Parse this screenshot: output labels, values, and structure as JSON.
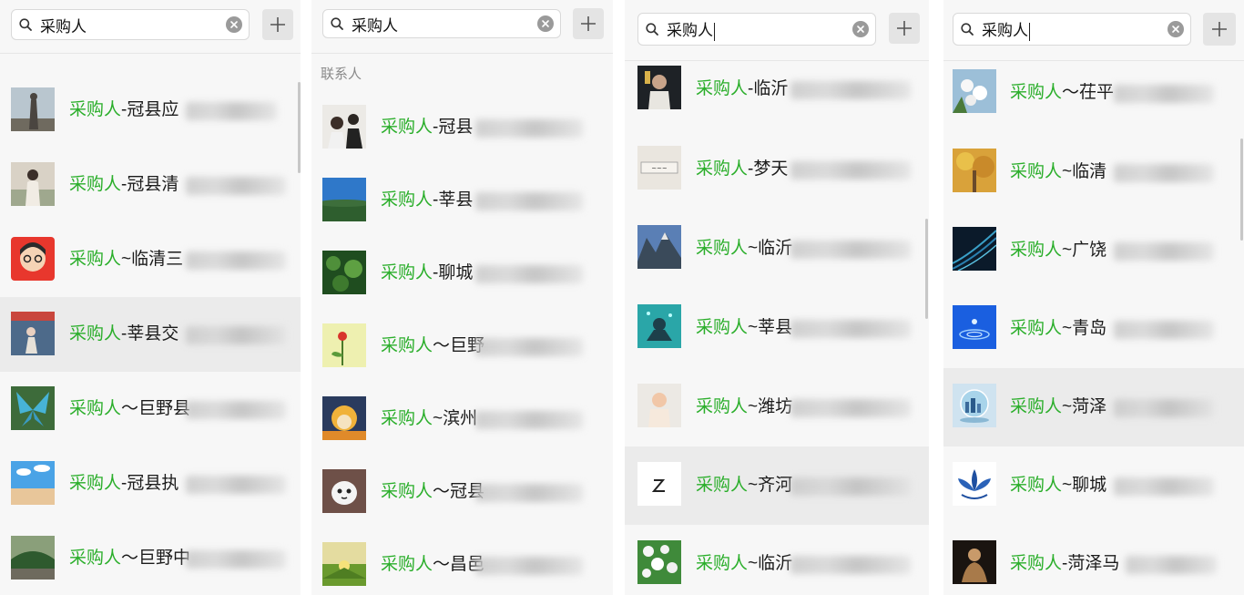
{
  "search": {
    "query": "采购人"
  },
  "panel2": {
    "section_label": "联系人"
  },
  "keyword": "采购人",
  "panel1": {
    "rows": [
      {
        "name": "-冠县应"
      },
      {
        "name": "-冠县清"
      },
      {
        "name": "~临清三"
      },
      {
        "name": "-莘县交"
      },
      {
        "name": "～巨野县"
      },
      {
        "name": "-冠县执"
      },
      {
        "name": "～巨野中"
      }
    ]
  },
  "panel2_rows": [
    {
      "name": "-冠县"
    },
    {
      "name": "-莘县"
    },
    {
      "name": "-聊城"
    },
    {
      "name": "～巨野"
    },
    {
      "name": "~滨州"
    },
    {
      "name": "～冠县"
    },
    {
      "name": "～昌邑"
    }
  ],
  "panel3_rows": [
    {
      "name": "-临沂"
    },
    {
      "name": "-梦天"
    },
    {
      "name": "~临沂"
    },
    {
      "name": "~莘县"
    },
    {
      "name": "~潍坊"
    },
    {
      "name": "~齐河"
    },
    {
      "name": "~临沂"
    }
  ],
  "panel4_rows": [
    {
      "name": "～茌平"
    },
    {
      "name": "~临清"
    },
    {
      "name": "~广饶"
    },
    {
      "name": "~青岛"
    },
    {
      "name": "~菏泽"
    },
    {
      "name": "~聊城"
    },
    {
      "name": "-菏泽马"
    }
  ],
  "colors": {
    "highlight": "#2aae2a",
    "text": "#1b1b1b",
    "panel_bg": "#f7f7f7",
    "active_row": "#ebebeb"
  },
  "icons": [
    "search-icon",
    "clear-icon",
    "plus-icon"
  ]
}
